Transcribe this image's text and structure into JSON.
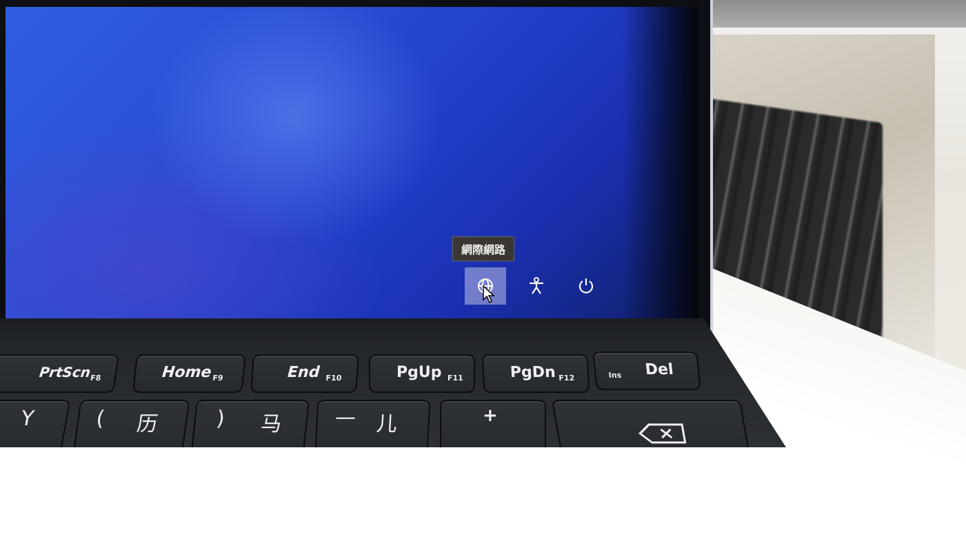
{
  "screen": {
    "tooltip": "網際網路",
    "icons": {
      "network": "globe-icon",
      "accessibility": "accessibility-icon",
      "power": "power-icon"
    }
  },
  "keyboard": {
    "fn_row": [
      {
        "label": "PrtScn",
        "fn": "F8"
      },
      {
        "label": "Home",
        "fn": "F9"
      },
      {
        "label": "End",
        "fn": "F10"
      },
      {
        "label": "PgUp",
        "fn": "F11"
      },
      {
        "label": "PgDn",
        "fn": "F12"
      },
      {
        "label": "Del",
        "fn": "Ins"
      }
    ],
    "row2": [
      {
        "a": "Y",
        "b": ""
      },
      {
        "a": "(",
        "b": "历"
      },
      {
        "a": ")",
        "b": "马"
      },
      {
        "a": "—",
        "b": "儿"
      },
      {
        "a": "+",
        "b": ""
      },
      {
        "a": "",
        "b": "backspace-icon"
      }
    ]
  },
  "colors": {
    "screen_blue": "#2a4fd6",
    "key_dark": "#2b2e33",
    "tooltip_bg": "#3a3733"
  }
}
